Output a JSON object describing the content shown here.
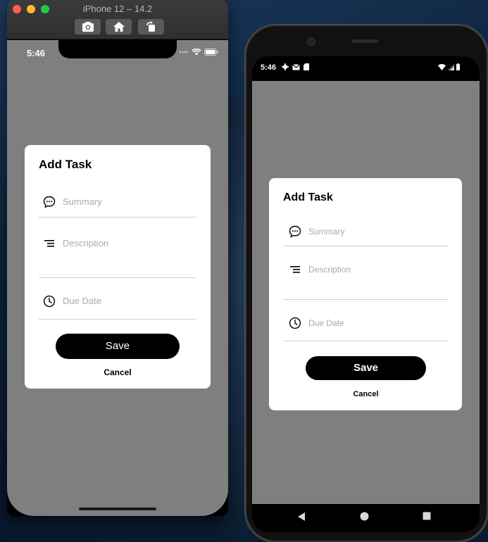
{
  "simulator": {
    "title": "iPhone 12 – 14.2",
    "toolbar": [
      {
        "name": "screenshot-button",
        "icon": "camera-icon"
      },
      {
        "name": "home-button",
        "icon": "home-icon"
      },
      {
        "name": "rotate-button",
        "icon": "rotate-icon"
      }
    ]
  },
  "ios": {
    "status": {
      "time": "5:46",
      "icons": [
        "signal-dots-icon",
        "wifi-icon",
        "battery-icon"
      ]
    }
  },
  "android": {
    "status": {
      "time": "5:46",
      "left_icons": [
        "gear-icon",
        "mail-icon",
        "sd-card-icon"
      ],
      "right_icons": [
        "wifi-icon",
        "signal-icon",
        "battery-icon"
      ]
    },
    "navbar": [
      "back-icon",
      "home-circle-icon",
      "recents-icon"
    ]
  },
  "dialog": {
    "title": "Add Task",
    "fields": [
      {
        "icon": "chat-bubble-icon",
        "placeholder": "Summary"
      },
      {
        "icon": "text-lines-icon",
        "placeholder": "Description"
      },
      {
        "icon": "clock-icon",
        "placeholder": "Due Date"
      }
    ],
    "save_label": "Save",
    "cancel_label": "Cancel"
  },
  "colors": {
    "overlay": "#7f7f7f",
    "dialog_bg": "#ffffff",
    "button_bg": "#000000",
    "placeholder": "#a9a9a9"
  }
}
